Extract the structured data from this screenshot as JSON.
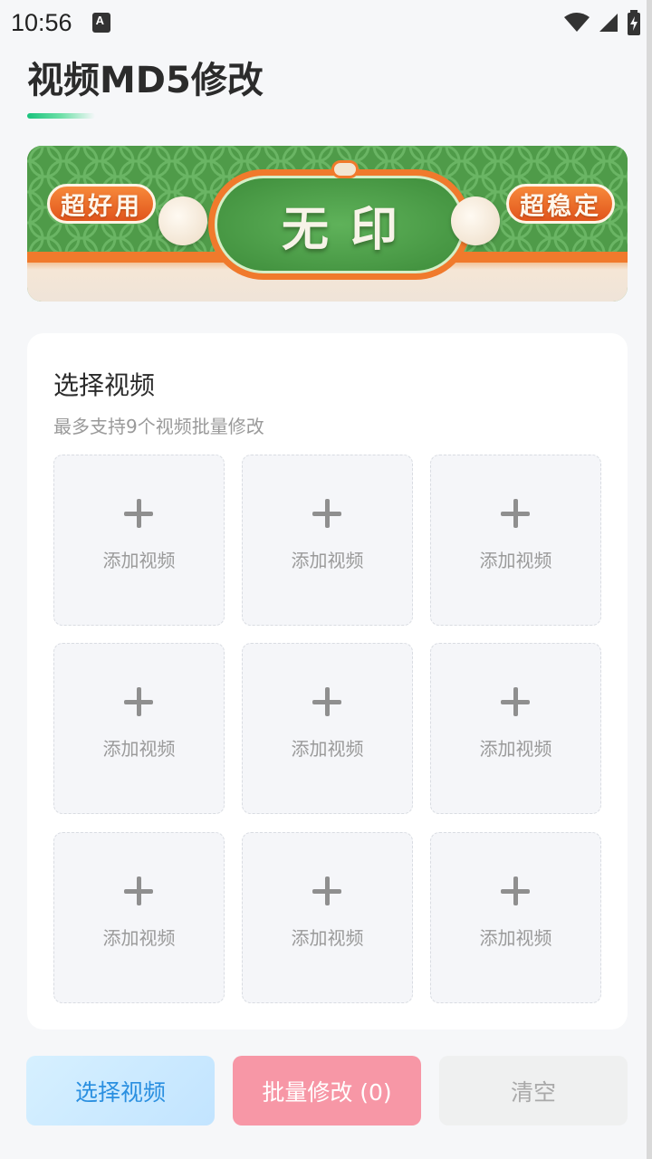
{
  "status_bar": {
    "time": "10:56",
    "icons": [
      "a-notification-icon",
      "wifi-icon",
      "signal-icon",
      "battery-charging-icon"
    ]
  },
  "header": {
    "title": "视频MD5修改",
    "accent_color": "#19c37d"
  },
  "banner": {
    "left_tag": "超好用",
    "center_text": "无印",
    "right_tag": "超稳定"
  },
  "picker": {
    "title": "选择视频",
    "subtitle": "最多支持9个视频批量修改",
    "slots": [
      {
        "label": "添加视频"
      },
      {
        "label": "添加视频"
      },
      {
        "label": "添加视频"
      },
      {
        "label": "添加视频"
      },
      {
        "label": "添加视频"
      },
      {
        "label": "添加视频"
      },
      {
        "label": "添加视频"
      },
      {
        "label": "添加视频"
      },
      {
        "label": "添加视频"
      }
    ]
  },
  "actions": {
    "select_label": "选择视频",
    "batch_label": "批量修改 (0)",
    "clear_label": "清空",
    "select_color": "#2a8fe0",
    "batch_color": "#f797a6"
  }
}
